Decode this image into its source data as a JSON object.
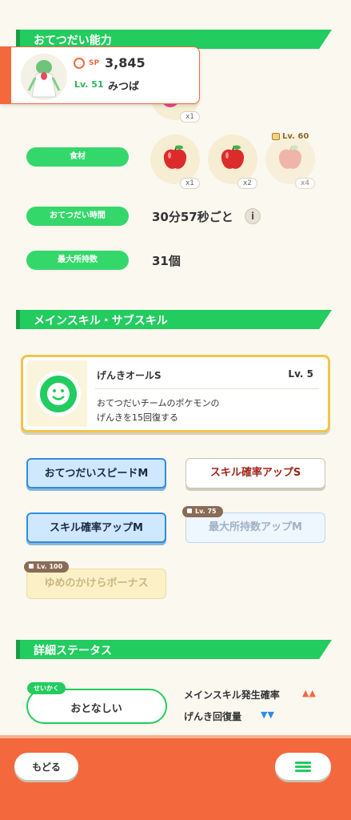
{
  "sections": {
    "help_ability": "おてつだい能力",
    "skills": "メインスキル・サブスキル",
    "details": "詳細ステータス"
  },
  "profile": {
    "sp_badge": "SP",
    "sp_value": "3,845",
    "level": "Lv. 51",
    "name": "みつば"
  },
  "berry_qty": "x1",
  "ingredients": {
    "label": "食材",
    "items": [
      {
        "qty": "x1"
      },
      {
        "qty": "x2"
      },
      {
        "qty": "x4",
        "lock_level": "Lv. 60"
      }
    ]
  },
  "help_time": {
    "label": "おてつだい時間",
    "value": "30分57秒ごと",
    "info_icon": "i"
  },
  "max_inventory": {
    "label": "最大所持数",
    "value": "31個"
  },
  "main_skill": {
    "name": "げんきオールS",
    "level": "Lv. 5",
    "description_line1": "おてつだいチームのポケモンの",
    "description_line2": "げんきを15回復する"
  },
  "sub_skills": [
    {
      "label": "おてつだいスピードM"
    },
    {
      "label": "スキル確率アップS"
    },
    {
      "label": "スキル確率アップM"
    },
    {
      "label": "最大所持数アップM",
      "lock_level": "Lv. 75"
    },
    {
      "label": "ゆめのかけらボーナス",
      "lock_level": "Lv. 100"
    }
  ],
  "nature": {
    "tag": "せいかく",
    "value": "おとなしい",
    "effects": [
      {
        "label": "メインスキル発生確率",
        "arrows": "▲▲",
        "color": "#f4683d"
      },
      {
        "label": "げんき回復量",
        "arrows": "▼▼",
        "color": "#2f8de0"
      }
    ]
  },
  "nav": {
    "back_label": "もどる"
  },
  "colors": {
    "accent_green": "#22cc5e",
    "bottom_bar": "#f4683d",
    "skill_border": "#f1c44c"
  }
}
